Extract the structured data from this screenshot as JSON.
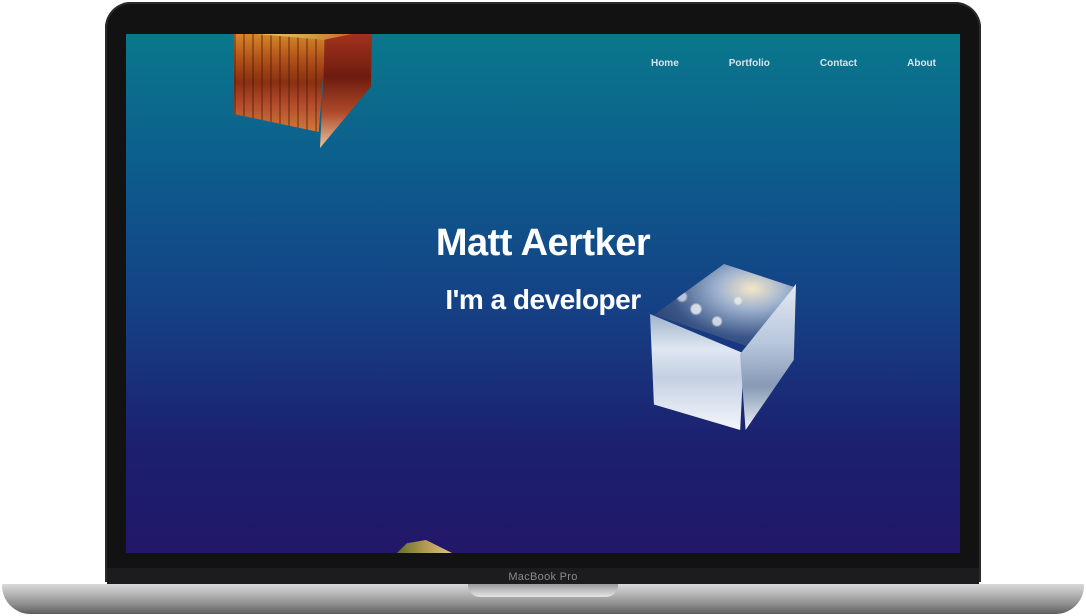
{
  "device": {
    "brand_label": "MacBook Pro"
  },
  "nav": {
    "items": [
      {
        "label": "Home"
      },
      {
        "label": "Portfolio"
      },
      {
        "label": "Contact"
      },
      {
        "label": "About"
      }
    ]
  },
  "hero": {
    "title": "Matt Aertker",
    "subtitle": "I'm a developer"
  },
  "colors": {
    "gradient_top": "#0a788c",
    "gradient_bottom": "#221769",
    "text": "#ffffff"
  },
  "decor": {
    "cubes": [
      {
        "name": "autumn-forest-cube"
      },
      {
        "name": "snowy-mountain-cube"
      },
      {
        "name": "partial-cube-bottom"
      }
    ]
  }
}
